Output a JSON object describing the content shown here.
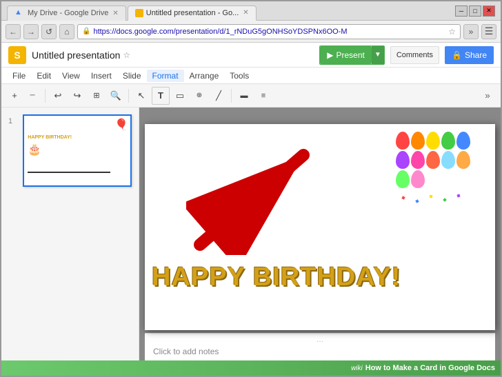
{
  "browser": {
    "tabs": [
      {
        "id": "tab1",
        "label": "My Drive - Google Drive",
        "active": false,
        "favicon": "▲"
      },
      {
        "id": "tab2",
        "label": "Untitled presentation - Go...",
        "active": true,
        "favicon": "🟧"
      }
    ],
    "url": "https://docs.google.com/presentation/d/1_rNDuG5gONHSoYDSPNx6OO-M",
    "nav": {
      "back": "←",
      "forward": "→",
      "refresh": "↺",
      "home": "⌂"
    },
    "window_controls": {
      "minimize": "─",
      "maximize": "□",
      "close": "✕"
    }
  },
  "app": {
    "logo": "S",
    "title": "Untitled presentation",
    "star": "☆",
    "menu_items": [
      "File",
      "Edit",
      "View",
      "Insert",
      "Slide",
      "Format",
      "Arrange",
      "Tools"
    ],
    "toolbar": {
      "tools": [
        "+",
        "─",
        "↩",
        "↪",
        "⊞",
        "🔍",
        "↖",
        "T",
        "▭",
        "◎",
        "—",
        "▬",
        "≡"
      ],
      "collapse": "»"
    },
    "header_right": {
      "present_label": "Present",
      "present_dropdown": "▼",
      "comments_label": "Comments",
      "share_icon": "🔒",
      "share_label": "Share"
    }
  },
  "slides_panel": {
    "slide_number": "1"
  },
  "slide_content": {
    "birthday_text": "HAPPY BIRTHDAY!",
    "notes_placeholder": "Click to add notes"
  },
  "wikihow": {
    "label": "How to Make a Card in Google Docs"
  },
  "balloons": {
    "colors": [
      "#ff4444",
      "#ff8800",
      "#ffdd00",
      "#44cc44",
      "#4488ff",
      "#aa44ff",
      "#ff44aa",
      "#ff6644",
      "#88ddff",
      "#ffaa44",
      "#66ff66",
      "#ff88cc"
    ]
  }
}
